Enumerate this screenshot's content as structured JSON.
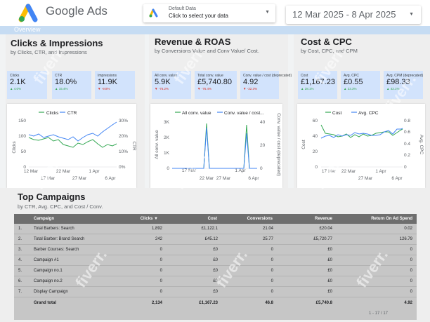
{
  "header": {
    "brand": "Google Ads",
    "data_selector": {
      "line1": "Default Data",
      "line2": "Click to select your data"
    },
    "date_range": "12 Mar 2025 - 8 Apr 2025"
  },
  "overview_label": "Overview",
  "sections": {
    "clicks": {
      "title": "Clicks & Impressions",
      "subtitle": "by Clicks, CTR, and Impressions",
      "kpis": [
        {
          "label": "Clicks",
          "value": "2.1K",
          "change": "▲ 4.0%",
          "dir": "up"
        },
        {
          "label": "CTR",
          "value": "18.0%",
          "change": "▲ 15.4%",
          "dir": "up"
        },
        {
          "label": "Impressions",
          "value": "11.9K",
          "change": "▼ -9.8%",
          "dir": "down"
        }
      ],
      "legend": [
        "Clicks",
        "CTR"
      ],
      "y_left_ticks": [
        "150",
        "100",
        "50",
        "0"
      ],
      "y_right_ticks": [
        "30%",
        "20%",
        "10%",
        "0%"
      ],
      "x_ticks": [
        "12 Mar",
        "17 Mar",
        "22 Mar",
        "27 Mar",
        "1 Apr",
        "6 Apr"
      ],
      "y_left_label": "Clicks",
      "y_right_label": "CTR"
    },
    "revenue": {
      "title": "Revenue & ROAS",
      "subtitle": "by Conversions Value and Conv Value/ Cost.",
      "kpis": [
        {
          "label": "All conv. value",
          "value": "5.9K",
          "change": "▼ -76.2%",
          "dir": "down"
        },
        {
          "label": "Total conv. value",
          "value": "£5,740.80",
          "change": "▼ -76.4%",
          "dir": "down"
        },
        {
          "label": "Conv. value / cost (deprecated)",
          "value": "4.92",
          "change": "▼ -32.3%",
          "dir": "down"
        }
      ],
      "legend": [
        "All conv. value",
        "Conv. value / cost..."
      ],
      "y_left_ticks": [
        "3K",
        "2K",
        "1K",
        "0"
      ],
      "y_right_ticks": [
        "40",
        "20",
        "0"
      ],
      "x_ticks": [
        "17 Mar",
        "22 Mar",
        "27 Mar",
        "1 Apr",
        "6 Apr"
      ],
      "y_left_label": "All conv. value",
      "y_right_label": "Conv. value / cost (deprecated)"
    },
    "cost": {
      "title": "Cost & CPC",
      "subtitle": "by Cost, CPC, and CPM",
      "kpis": [
        {
          "label": "Cost",
          "value": "£1,167.23",
          "change": "▲ 28.1%",
          "dir": "up"
        },
        {
          "label": "Avg. CPC",
          "value": "£0.55",
          "change": "▲ 23.3%",
          "dir": "up"
        },
        {
          "label": "Avg. CPM (deprecated)",
          "value": "£98.33",
          "change": "▲ 42.1%",
          "dir": "up"
        }
      ],
      "legend": [
        "Cost",
        "Avg. CPC"
      ],
      "y_left_ticks": [
        "60",
        "40",
        "20",
        "0"
      ],
      "y_right_ticks": [
        "0.8",
        "0.6",
        "0.4",
        "0.2",
        "0"
      ],
      "x_ticks": [
        "17 Mar",
        "22 Mar",
        "27 Mar",
        "1 Apr",
        "6 Apr"
      ],
      "y_left_label": "Cost",
      "y_right_label": "Avg. CPC"
    }
  },
  "campaigns": {
    "title": "Top Campaigns",
    "subtitle": "by CTR, Avg. CPC, and Cost / Conv.",
    "columns": [
      "Campaign",
      "Clicks ▼",
      "Cost",
      "Conversions",
      "Revenue",
      "Return On Ad Spend"
    ],
    "rows": [
      {
        "num": "1.",
        "name": "Total Barbers: Search",
        "clicks": "1,892",
        "cost": "£1,122.1",
        "conv": "21.04",
        "rev": "£20.04",
        "roas": "0.02"
      },
      {
        "num": "2.",
        "name": "Total Barber: Brand Search",
        "clicks": "242",
        "cost": "£45.12",
        "conv": "25.77",
        "rev": "£5,720.77",
        "roas": "126.79"
      },
      {
        "num": "3.",
        "name": "Barber Courses: Search",
        "clicks": "0",
        "cost": "£0",
        "conv": "0",
        "rev": "£0",
        "roas": "0"
      },
      {
        "num": "4.",
        "name": "Campaign #1",
        "clicks": "0",
        "cost": "£0",
        "conv": "0",
        "rev": "£0",
        "roas": "0"
      },
      {
        "num": "5.",
        "name": "Campaign no.1",
        "clicks": "0",
        "cost": "£0",
        "conv": "0",
        "rev": "£0",
        "roas": "0"
      },
      {
        "num": "6.",
        "name": "Campaign no.2",
        "clicks": "0",
        "cost": "£0",
        "conv": "0",
        "rev": "£0",
        "roas": "0"
      },
      {
        "num": "7.",
        "name": "Display Campaign",
        "clicks": "0",
        "cost": "£0",
        "conv": "0",
        "rev": "£0",
        "roas": "0"
      }
    ],
    "grand_total": {
      "label": "Grand total",
      "clicks": "2,134",
      "cost": "£1,167.23",
      "conv": "46.8",
      "rev": "£5,740.8",
      "roas": "4.92"
    },
    "pager": "1 - 17 / 17"
  },
  "watermark": "fiverr.",
  "colors": {
    "green": "#34a853",
    "blue": "#4285f4",
    "kpi_bg": "#d2e3fc"
  }
}
